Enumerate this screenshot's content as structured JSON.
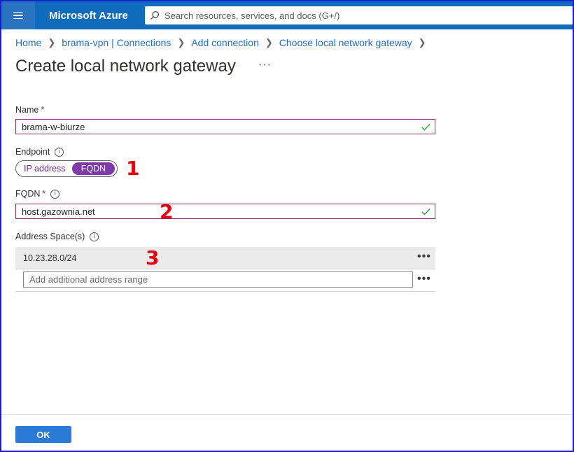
{
  "header": {
    "brand": "Microsoft Azure",
    "search_placeholder": "Search resources, services, and docs (G+/)"
  },
  "breadcrumb": [
    "Home",
    "brama-vpn | Connections",
    "Add connection",
    "Choose local network gateway"
  ],
  "page": {
    "title": "Create local network gateway",
    "more": "···"
  },
  "form": {
    "name_label": "Name",
    "name_value": "brama-w-biurze",
    "endpoint_label": "Endpoint",
    "endpoint_options": [
      "IP address",
      "FQDN"
    ],
    "endpoint_selected": "FQDN",
    "fqdn_label": "FQDN",
    "fqdn_value": "host.gazownia.net",
    "address_label": "Address Space(s)",
    "address_values": [
      "10.23.28.0/24"
    ],
    "address_placeholder": "Add additional address range",
    "required_marker": "*",
    "info_glyph": "i",
    "row_more": "•••"
  },
  "annotations": [
    "1",
    "2",
    "3"
  ],
  "footer": {
    "ok_label": "OK"
  },
  "colors": {
    "topbar": "#0f6cbd",
    "accent": "#7d3aa8",
    "annotation": "#e4000f",
    "ok_button": "#2a7ad6"
  }
}
